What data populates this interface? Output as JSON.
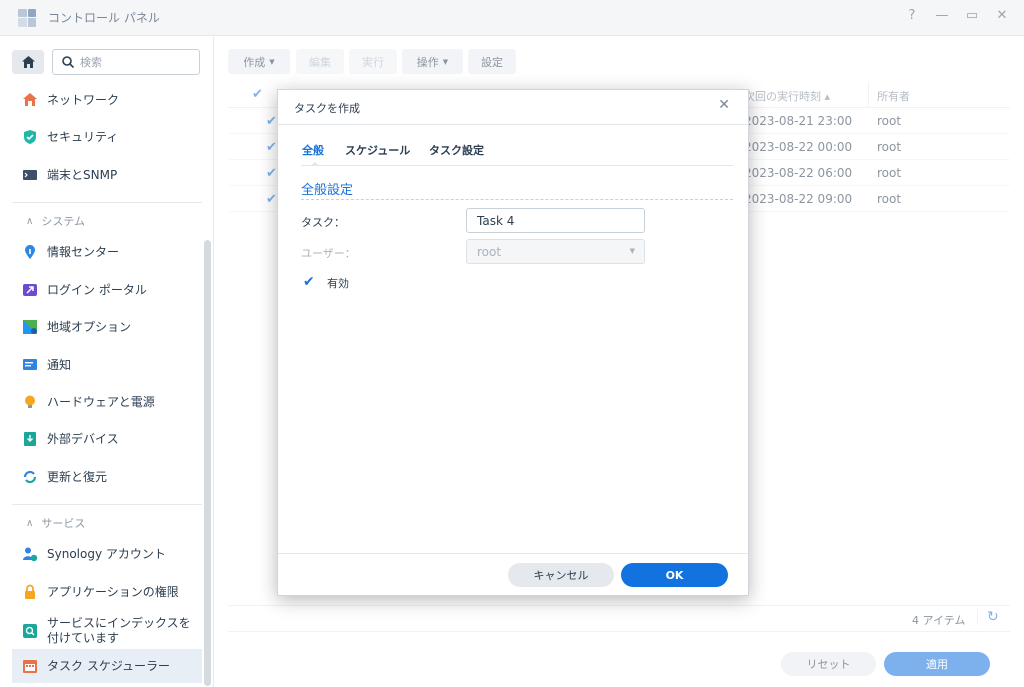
{
  "window": {
    "title": "コントロール パネル",
    "controls": [
      "?",
      "—",
      "▭",
      "✕"
    ]
  },
  "sidebar": {
    "search_placeholder": "検索",
    "top_items": [
      {
        "label": "ネットワーク",
        "icon": "house-network-icon"
      },
      {
        "label": "セキュリティ",
        "icon": "shield-icon"
      },
      {
        "label": "端末とSNMP",
        "icon": "terminal-icon"
      }
    ],
    "system_header": "システム",
    "system_items": [
      {
        "label": "情報センター",
        "icon": "info-icon"
      },
      {
        "label": "ログイン ポータル",
        "icon": "login-portal-icon"
      },
      {
        "label": "地域オプション",
        "icon": "region-icon"
      },
      {
        "label": "通知",
        "icon": "notification-icon"
      },
      {
        "label": "ハードウェアと電源",
        "icon": "bulb-icon"
      },
      {
        "label": "外部デバイス",
        "icon": "external-device-icon"
      },
      {
        "label": "更新と復元",
        "icon": "update-icon"
      }
    ],
    "services_header": "サービス",
    "services_items": [
      {
        "label": "Synology アカウント",
        "icon": "account-icon"
      },
      {
        "label": "アプリケーションの権限",
        "icon": "lock-icon"
      },
      {
        "label": "サービスにインデックスを付けています",
        "icon": "index-icon"
      },
      {
        "label": "タスク スケジューラー",
        "icon": "calendar-icon"
      }
    ]
  },
  "toolbar": {
    "create": "作成",
    "edit": "編集",
    "run": "実行",
    "action": "操作",
    "settings": "設定"
  },
  "grid": {
    "col_next_run": "次回の実行時刻",
    "col_owner": "所有者",
    "rows": [
      {
        "next_run": "2023-08-21 23:00",
        "owner": "root"
      },
      {
        "next_run": "2023-08-22 00:00",
        "owner": "root"
      },
      {
        "next_run": "2023-08-22 06:00",
        "owner": "root"
      },
      {
        "next_run": "2023-08-22 09:00",
        "owner": "root"
      }
    ],
    "item_count": "4 アイテム"
  },
  "footer": {
    "reset": "リセット",
    "apply": "適用"
  },
  "dialog": {
    "title": "タスクを作成",
    "tabs": [
      "全般",
      "スケジュール",
      "タスク設定"
    ],
    "section_title": "全般設定",
    "task_label": "タスク：",
    "task_value": "Task 4",
    "user_label": "ユーザー：",
    "user_value": "root",
    "enabled_label": "有効",
    "cancel": "キャンセル",
    "ok": "OK"
  },
  "colors": {
    "accent": "#1172e0",
    "link": "#1a73d9"
  }
}
